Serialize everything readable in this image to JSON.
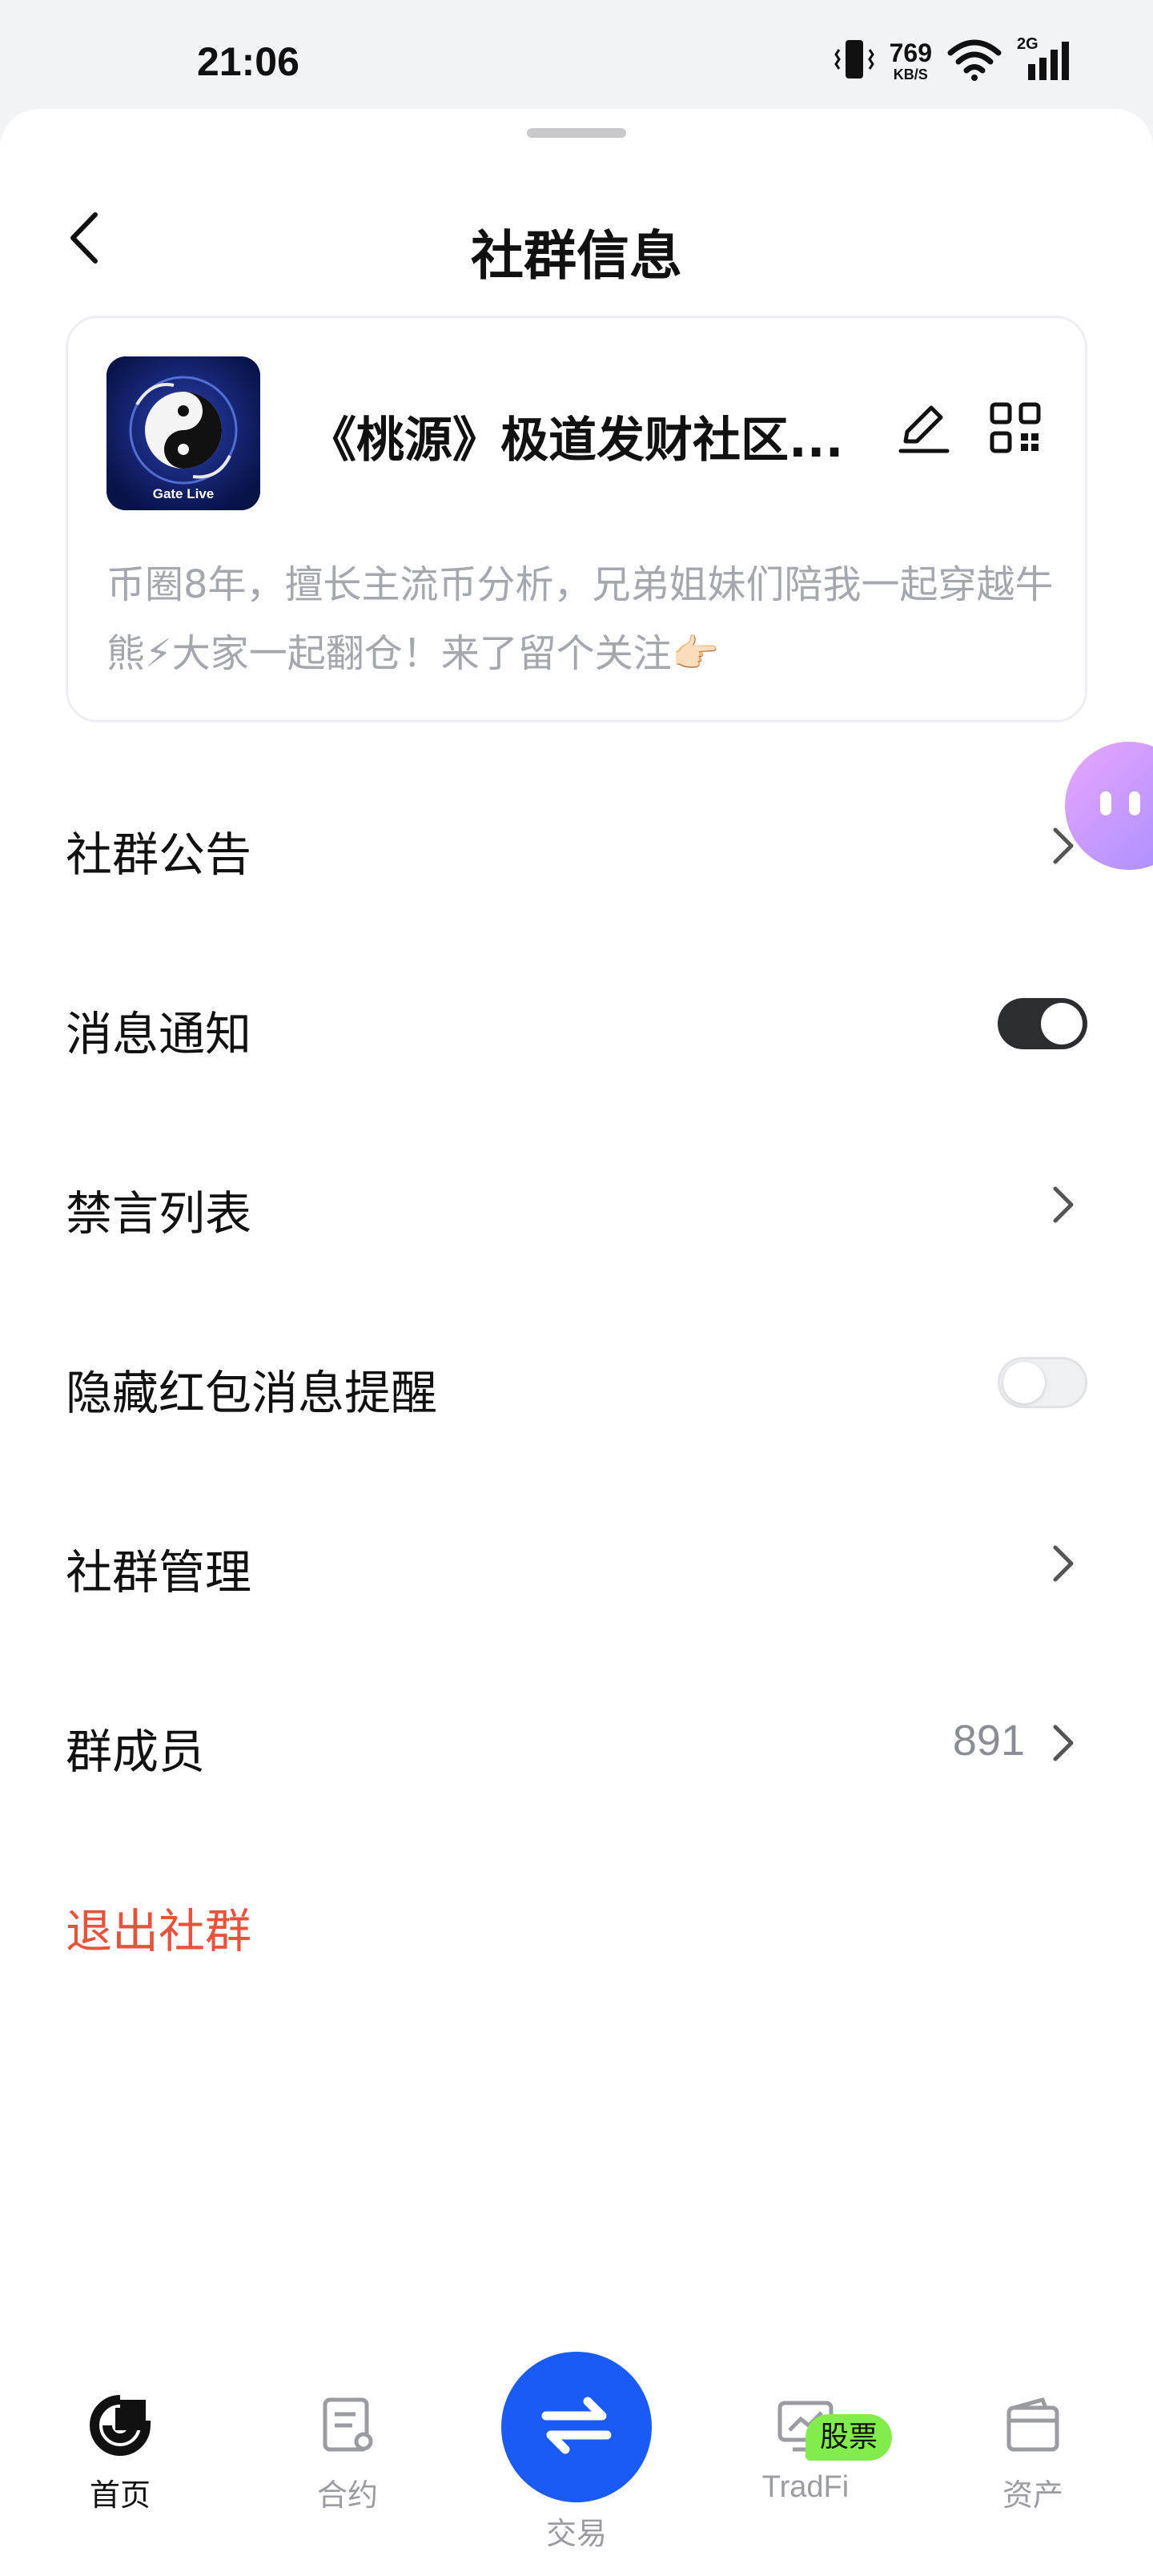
{
  "status_bar": {
    "time": "21:06",
    "net_speed": "769",
    "net_unit": "KB/S",
    "network_type": "2G",
    "icons": [
      "vibrate-icon",
      "wifi-icon",
      "signal-icon"
    ]
  },
  "header": {
    "title": "社群信息",
    "back_icon": "chevron-left-icon"
  },
  "group": {
    "name": "《桃源》极道发财社区...",
    "avatar_caption": "Gate Live",
    "description": "币圈8年，擅长主流币分析，兄弟姐妹们陪我一起穿越牛熊⚡大家一起翻仓！来了留个关注👉🏻",
    "edit_icon": "pencil-icon",
    "qr_icon": "qr-code-icon"
  },
  "menu": {
    "announcement": "社群公告",
    "notifications": "消息通知",
    "notifications_on": true,
    "mute_list": "禁言列表",
    "hide_red_packet": "隐藏红包消息提醒",
    "hide_red_packet_on": false,
    "management": "社群管理",
    "members": "群成员",
    "member_count": "891",
    "leave": "退出社群"
  },
  "tabbar": {
    "home": "首页",
    "contract": "合约",
    "trade": "交易",
    "tradfi": "TradFi",
    "tradfi_badge": "股票",
    "assets": "资产"
  },
  "colors": {
    "accent": "#1a5bf5",
    "danger": "#e5533d",
    "badge": "#82ec4c",
    "toggle_on": "#2b2d31"
  }
}
